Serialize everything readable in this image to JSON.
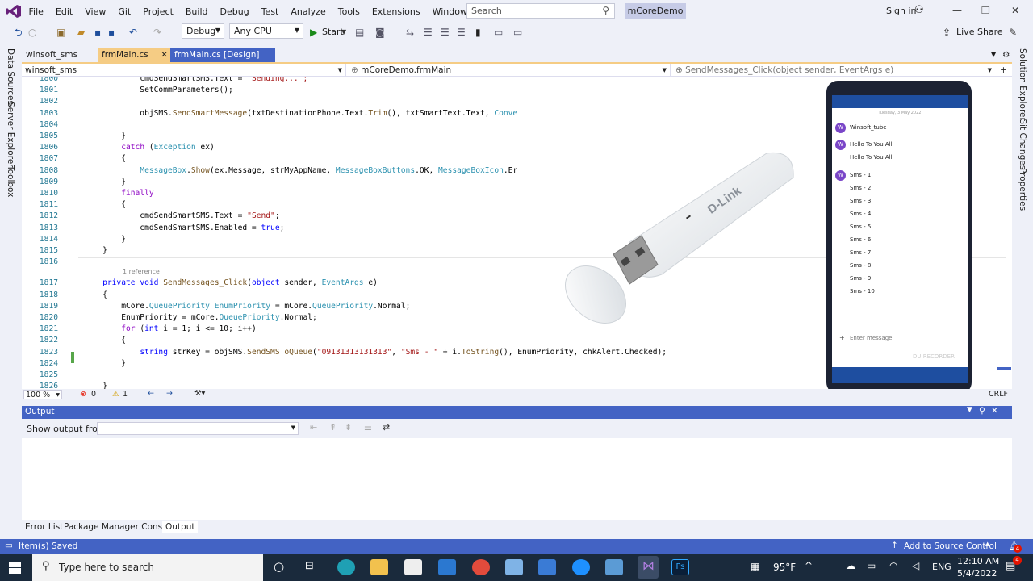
{
  "menubar": {
    "items": [
      "File",
      "Edit",
      "View",
      "Git",
      "Project",
      "Build",
      "Debug",
      "Test",
      "Analyze",
      "Tools",
      "Extensions",
      "Window",
      "Help"
    ],
    "search_placeholder": "Search",
    "solution_name": "mCoreDemo",
    "signin": "Sign in"
  },
  "toolbar": {
    "config": "Debug",
    "platform": "Any CPU",
    "start": "Start",
    "live_share": "Live Share"
  },
  "leftbar": {
    "items": [
      "Data Sources",
      "Server Explorer",
      "Toolbox"
    ]
  },
  "rightbar": {
    "items": [
      "Solution Explorer",
      "Git Changes",
      "Properties"
    ]
  },
  "tabs": [
    {
      "label": "winsoft_sms"
    },
    {
      "label": "frmMain.cs"
    },
    {
      "label": "frmMain.cs [Design]"
    }
  ],
  "navbar": {
    "project": "winsoft_sms",
    "class": "mCoreDemo.frmMain",
    "member": "SendMessages_Click(object sender, EventArgs e)"
  },
  "editor": {
    "line_numbers": [
      "1800",
      "1801",
      "1802",
      "1803",
      "1804",
      "1805",
      "1806",
      "1807",
      "1808",
      "1809",
      "1810",
      "1811",
      "1812",
      "1813",
      "1814",
      "1815",
      "1816",
      "1817",
      "1818",
      "1819",
      "1820",
      "1821",
      "1822",
      "1823",
      "1824",
      "1825",
      "1826"
    ],
    "reference_hint": "1 reference"
  },
  "editor_status": {
    "zoom": "100 %",
    "errors": "0",
    "warnings": "1",
    "line_ending": "CRLF"
  },
  "output": {
    "title": "Output",
    "show_from_label": "Show output from:"
  },
  "bottom_tabs": [
    "Error List",
    "Package Manager Console",
    "Output"
  ],
  "statusbar": {
    "message": "Item(s) Saved",
    "source_control": "Add to Source Control",
    "badge": "4"
  },
  "taskbar": {
    "search_placeholder": "Type here to search",
    "temperature": "95°F",
    "language": "ENG",
    "time": "12:10 AM",
    "date": "5/4/2022",
    "notification_count": "4"
  },
  "phone": {
    "date_header": "Tuesday, 3 May 2022",
    "messages": [
      "Winsoft_tube",
      "Hello To You All",
      "Hello To You All",
      "Sms - 1",
      "Sms - 2",
      "Sms - 3",
      "Sms - 4",
      "Sms - 5",
      "Sms - 6",
      "Sms - 7",
      "Sms - 8",
      "Sms - 9",
      "Sms - 10"
    ],
    "input_placeholder": "Enter message",
    "watermark": "DU RECORDER"
  },
  "modem": {
    "brand": "D-Link"
  },
  "colors": {
    "accent": "#4363c4",
    "vs_purple": "#68217a",
    "taskbar": "#1a2a3c"
  }
}
